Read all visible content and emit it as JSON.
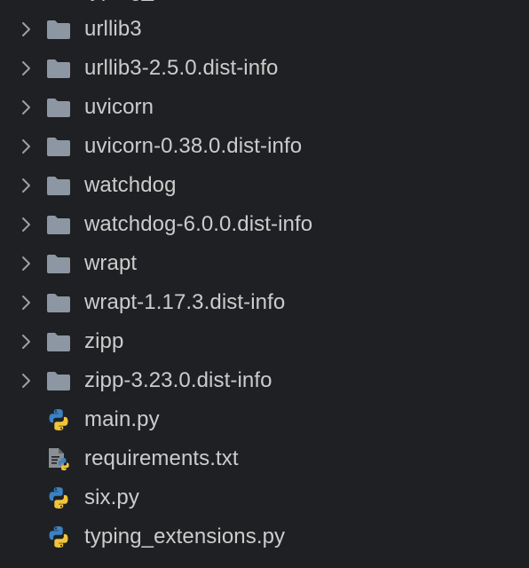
{
  "explorer": {
    "partial_top_label": "typing_extensions",
    "folders": [
      {
        "label": "urllib3",
        "icon": "folder-icon"
      },
      {
        "label": "urllib3-2.5.0.dist-info",
        "icon": "folder-icon"
      },
      {
        "label": "uvicorn",
        "icon": "folder-icon"
      },
      {
        "label": "uvicorn-0.38.0.dist-info",
        "icon": "folder-icon"
      },
      {
        "label": "watchdog",
        "icon": "folder-icon"
      },
      {
        "label": "watchdog-6.0.0.dist-info",
        "icon": "folder-icon"
      },
      {
        "label": "wrapt",
        "icon": "folder-icon"
      },
      {
        "label": "wrapt-1.17.3.dist-info",
        "icon": "folder-icon"
      },
      {
        "label": "zipp",
        "icon": "folder-icon"
      },
      {
        "label": "zipp-3.23.0.dist-info",
        "icon": "folder-icon"
      }
    ],
    "files": [
      {
        "label": "main.py",
        "icon": "python-icon"
      },
      {
        "label": "requirements.txt",
        "icon": "python-requirements-icon"
      },
      {
        "label": "six.py",
        "icon": "python-icon"
      },
      {
        "label": "typing_extensions.py",
        "icon": "python-icon"
      }
    ],
    "colors": {
      "background": "#1f2023",
      "text": "#cccccc",
      "chevron": "#a0a0a0",
      "folder": "#8c97a3",
      "python_blue": "#3b82c4",
      "python_yellow": "#f2c43a",
      "doc_gray": "#8a8f96"
    }
  }
}
